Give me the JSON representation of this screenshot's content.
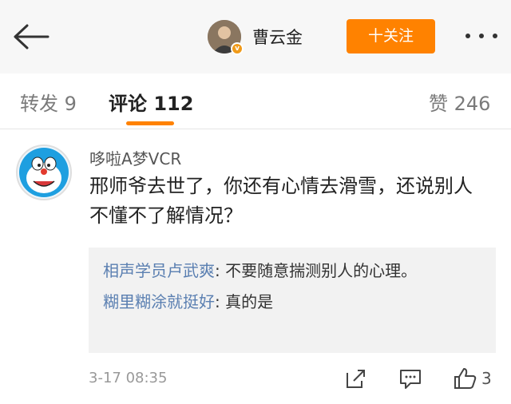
{
  "header": {
    "username": "曹云金",
    "follow_label": "十关注",
    "verified_mark": "v"
  },
  "tabs": [
    {
      "label": "转发 9"
    },
    {
      "label": "评论 112"
    },
    {
      "label": "赞 246"
    }
  ],
  "comment": {
    "author": "哆啦A梦VCR",
    "body": "邢师爷去世了，你还有心情去滑雪，还说别人不懂不了解情况？",
    "replies": [
      {
        "name": "相声学员卢武爽",
        "text": ": 不要随意揣测别人的心理。"
      },
      {
        "name": "糊里糊涂就挺好",
        "text": ": 真的是"
      }
    ],
    "time": "3-17 08:35",
    "like_count": "3"
  },
  "colors": {
    "accent": "#ff8200",
    "link": "#5a7fb1",
    "header_bg": "#f7f7f7",
    "reply_bg": "#f2f2f2"
  }
}
